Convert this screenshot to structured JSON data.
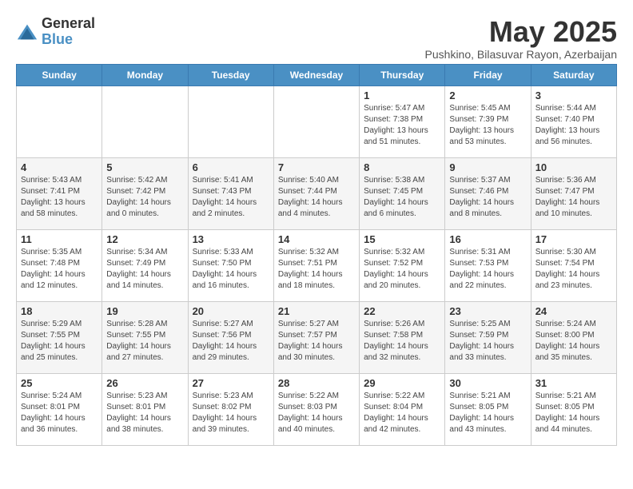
{
  "logo": {
    "general": "General",
    "blue": "Blue"
  },
  "title": "May 2025",
  "subtitle": "Pushkino, Bilasuvar Rayon, Azerbaijan",
  "days_of_week": [
    "Sunday",
    "Monday",
    "Tuesday",
    "Wednesday",
    "Thursday",
    "Friday",
    "Saturday"
  ],
  "weeks": [
    [
      {
        "day": "",
        "info": ""
      },
      {
        "day": "",
        "info": ""
      },
      {
        "day": "",
        "info": ""
      },
      {
        "day": "",
        "info": ""
      },
      {
        "day": "1",
        "info": "Sunrise: 5:47 AM\nSunset: 7:38 PM\nDaylight: 13 hours\nand 51 minutes."
      },
      {
        "day": "2",
        "info": "Sunrise: 5:45 AM\nSunset: 7:39 PM\nDaylight: 13 hours\nand 53 minutes."
      },
      {
        "day": "3",
        "info": "Sunrise: 5:44 AM\nSunset: 7:40 PM\nDaylight: 13 hours\nand 56 minutes."
      }
    ],
    [
      {
        "day": "4",
        "info": "Sunrise: 5:43 AM\nSunset: 7:41 PM\nDaylight: 13 hours\nand 58 minutes."
      },
      {
        "day": "5",
        "info": "Sunrise: 5:42 AM\nSunset: 7:42 PM\nDaylight: 14 hours\nand 0 minutes."
      },
      {
        "day": "6",
        "info": "Sunrise: 5:41 AM\nSunset: 7:43 PM\nDaylight: 14 hours\nand 2 minutes."
      },
      {
        "day": "7",
        "info": "Sunrise: 5:40 AM\nSunset: 7:44 PM\nDaylight: 14 hours\nand 4 minutes."
      },
      {
        "day": "8",
        "info": "Sunrise: 5:38 AM\nSunset: 7:45 PM\nDaylight: 14 hours\nand 6 minutes."
      },
      {
        "day": "9",
        "info": "Sunrise: 5:37 AM\nSunset: 7:46 PM\nDaylight: 14 hours\nand 8 minutes."
      },
      {
        "day": "10",
        "info": "Sunrise: 5:36 AM\nSunset: 7:47 PM\nDaylight: 14 hours\nand 10 minutes."
      }
    ],
    [
      {
        "day": "11",
        "info": "Sunrise: 5:35 AM\nSunset: 7:48 PM\nDaylight: 14 hours\nand 12 minutes."
      },
      {
        "day": "12",
        "info": "Sunrise: 5:34 AM\nSunset: 7:49 PM\nDaylight: 14 hours\nand 14 minutes."
      },
      {
        "day": "13",
        "info": "Sunrise: 5:33 AM\nSunset: 7:50 PM\nDaylight: 14 hours\nand 16 minutes."
      },
      {
        "day": "14",
        "info": "Sunrise: 5:32 AM\nSunset: 7:51 PM\nDaylight: 14 hours\nand 18 minutes."
      },
      {
        "day": "15",
        "info": "Sunrise: 5:32 AM\nSunset: 7:52 PM\nDaylight: 14 hours\nand 20 minutes."
      },
      {
        "day": "16",
        "info": "Sunrise: 5:31 AM\nSunset: 7:53 PM\nDaylight: 14 hours\nand 22 minutes."
      },
      {
        "day": "17",
        "info": "Sunrise: 5:30 AM\nSunset: 7:54 PM\nDaylight: 14 hours\nand 23 minutes."
      }
    ],
    [
      {
        "day": "18",
        "info": "Sunrise: 5:29 AM\nSunset: 7:55 PM\nDaylight: 14 hours\nand 25 minutes."
      },
      {
        "day": "19",
        "info": "Sunrise: 5:28 AM\nSunset: 7:55 PM\nDaylight: 14 hours\nand 27 minutes."
      },
      {
        "day": "20",
        "info": "Sunrise: 5:27 AM\nSunset: 7:56 PM\nDaylight: 14 hours\nand 29 minutes."
      },
      {
        "day": "21",
        "info": "Sunrise: 5:27 AM\nSunset: 7:57 PM\nDaylight: 14 hours\nand 30 minutes."
      },
      {
        "day": "22",
        "info": "Sunrise: 5:26 AM\nSunset: 7:58 PM\nDaylight: 14 hours\nand 32 minutes."
      },
      {
        "day": "23",
        "info": "Sunrise: 5:25 AM\nSunset: 7:59 PM\nDaylight: 14 hours\nand 33 minutes."
      },
      {
        "day": "24",
        "info": "Sunrise: 5:24 AM\nSunset: 8:00 PM\nDaylight: 14 hours\nand 35 minutes."
      }
    ],
    [
      {
        "day": "25",
        "info": "Sunrise: 5:24 AM\nSunset: 8:01 PM\nDaylight: 14 hours\nand 36 minutes."
      },
      {
        "day": "26",
        "info": "Sunrise: 5:23 AM\nSunset: 8:01 PM\nDaylight: 14 hours\nand 38 minutes."
      },
      {
        "day": "27",
        "info": "Sunrise: 5:23 AM\nSunset: 8:02 PM\nDaylight: 14 hours\nand 39 minutes."
      },
      {
        "day": "28",
        "info": "Sunrise: 5:22 AM\nSunset: 8:03 PM\nDaylight: 14 hours\nand 40 minutes."
      },
      {
        "day": "29",
        "info": "Sunrise: 5:22 AM\nSunset: 8:04 PM\nDaylight: 14 hours\nand 42 minutes."
      },
      {
        "day": "30",
        "info": "Sunrise: 5:21 AM\nSunset: 8:05 PM\nDaylight: 14 hours\nand 43 minutes."
      },
      {
        "day": "31",
        "info": "Sunrise: 5:21 AM\nSunset: 8:05 PM\nDaylight: 14 hours\nand 44 minutes."
      }
    ]
  ]
}
